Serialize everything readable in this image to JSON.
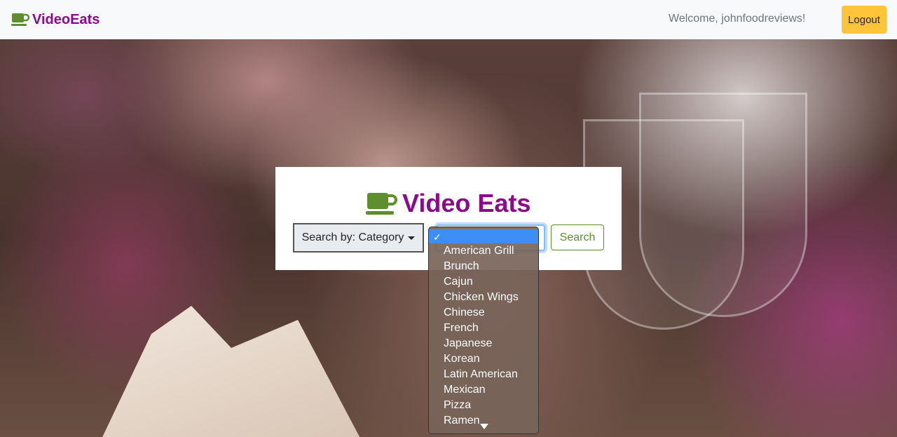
{
  "navbar": {
    "brand": "VideoEats",
    "welcome": "Welcome, johnfoodreviews!",
    "logout_label": "Logout"
  },
  "search_card": {
    "title": "Video Eats",
    "category_button_label": "Search by: Category",
    "search_button_label": "Search"
  },
  "category_dropdown": {
    "selected_index": 0,
    "options": [
      "",
      "American Grill",
      "Brunch",
      "Cajun",
      "Chicken Wings",
      "Chinese",
      "French",
      "Japanese",
      "Korean",
      "Latin American",
      "Mexican",
      "Pizza",
      "Ramen"
    ]
  },
  "colors": {
    "brand_purple": "#8b0a8a",
    "brand_green": "#5d8f2f",
    "logout_yellow": "#ffc439",
    "selected_blue": "#3d8ff5"
  }
}
